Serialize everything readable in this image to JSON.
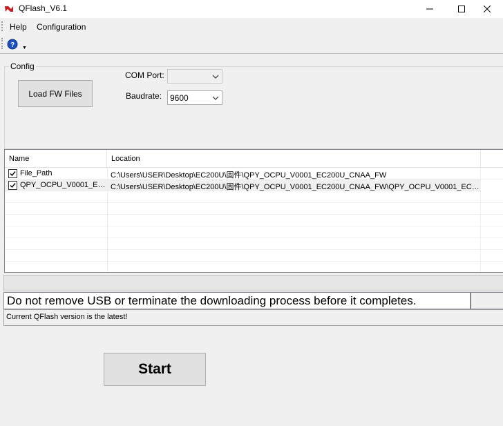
{
  "window": {
    "title": "QFlash_V6.1",
    "minimize_icon": "minimize-icon",
    "maximize_icon": "maximize-icon",
    "close_icon": "close-icon"
  },
  "menu": {
    "items": [
      "Help",
      "Configuration"
    ]
  },
  "toolbar": {
    "help_icon": "help-icon"
  },
  "config": {
    "group_label": "Config",
    "load_button": "Load FW Files",
    "com_port_label": "COM Port:",
    "com_port_value": "",
    "baudrate_label": "Baudrate:",
    "baudrate_value": "9600"
  },
  "file_list": {
    "columns": [
      "Name",
      "Location"
    ],
    "rows": [
      {
        "checked": true,
        "name": "File_Path",
        "location": "C:\\Users\\USER\\Desktop\\EC200U\\固件\\QPY_OCPU_V0001_EC200U_CNAA_FW"
      },
      {
        "checked": true,
        "name": "QPY_OCPU_V0001_EC...",
        "location": "C:\\Users\\USER\\Desktop\\EC200U\\固件\\QPY_OCPU_V0001_EC200U_CNAA_FW\\QPY_OCPU_V0001_EC200..."
      }
    ]
  },
  "status": {
    "warning": "Do not remove USB or terminate the downloading process before it completes.",
    "version_message": "Current QFlash version is the latest!"
  },
  "actions": {
    "start_button": "Start"
  },
  "colors": {
    "accent_red": "#c81e1e",
    "help_blue": "#1c4fbf",
    "window_bg": "#f0f0f0"
  }
}
